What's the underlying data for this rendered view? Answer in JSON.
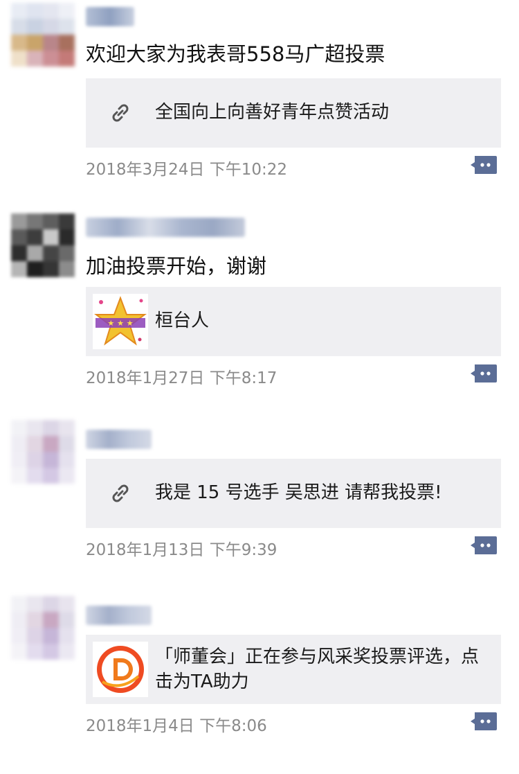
{
  "posts": [
    {
      "text": "欢迎大家为我表哥558马广超投票",
      "card": {
        "icon": "link-icon",
        "title": "全国向上向善好青年点赞活动"
      },
      "time": "2018年3月24日 下午10:22"
    },
    {
      "text": "加油投票开始，谢谢",
      "card": {
        "icon": "star-thumbnail",
        "title": "桓台人"
      },
      "time": "2018年1月27日 下午8:17"
    },
    {
      "text": "",
      "card": {
        "icon": "link-icon",
        "title": "我是 15 号选手 吴思进 请帮我投票!"
      },
      "time": "2018年1月13日 下午9:39"
    },
    {
      "text": "",
      "card": {
        "icon": "d-logo-thumbnail",
        "title": "「师董会」正在参与风采奖投票评选，点击为TA助力"
      },
      "time": "2018年1月4日 下午8:06"
    }
  ],
  "colors": {
    "card_bg": "#efeff2",
    "timestamp": "#8a8a8a",
    "comment_icon": "#5b6d96"
  }
}
